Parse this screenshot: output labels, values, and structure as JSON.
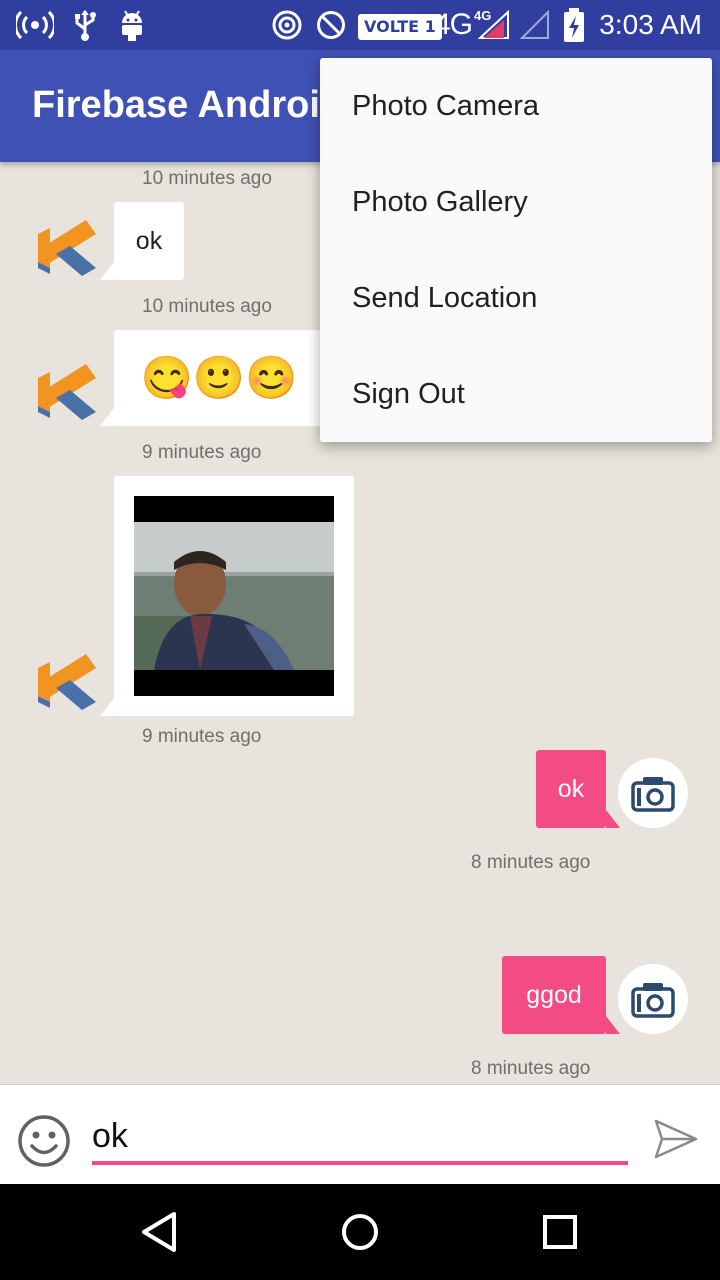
{
  "status_bar": {
    "volte": "VOLTE 1",
    "network": "4G",
    "network_small": "4G",
    "time": "3:03 AM"
  },
  "app_bar": {
    "title": "Firebase Android Chat"
  },
  "menu": {
    "items": [
      "Photo Camera",
      "Photo Gallery",
      "Send Location",
      "Sign Out"
    ]
  },
  "messages": [
    {
      "time": "10 minutes ago"
    },
    {
      "text": "ok",
      "time": "10 minutes ago"
    },
    {
      "emoji": "😋🙂😊",
      "time": "9 minutes ago"
    },
    {
      "type": "image",
      "time": "9 minutes ago"
    },
    {
      "text": "ok",
      "time": "8 minutes ago"
    },
    {
      "text": "ggod",
      "time": "8 minutes ago"
    }
  ],
  "input": {
    "value": "ok"
  },
  "colors": {
    "primary": "#3f51b5",
    "primary_dark": "#303f9f",
    "accent": "#f34b84",
    "chat_background": "#e8e3dd"
  }
}
